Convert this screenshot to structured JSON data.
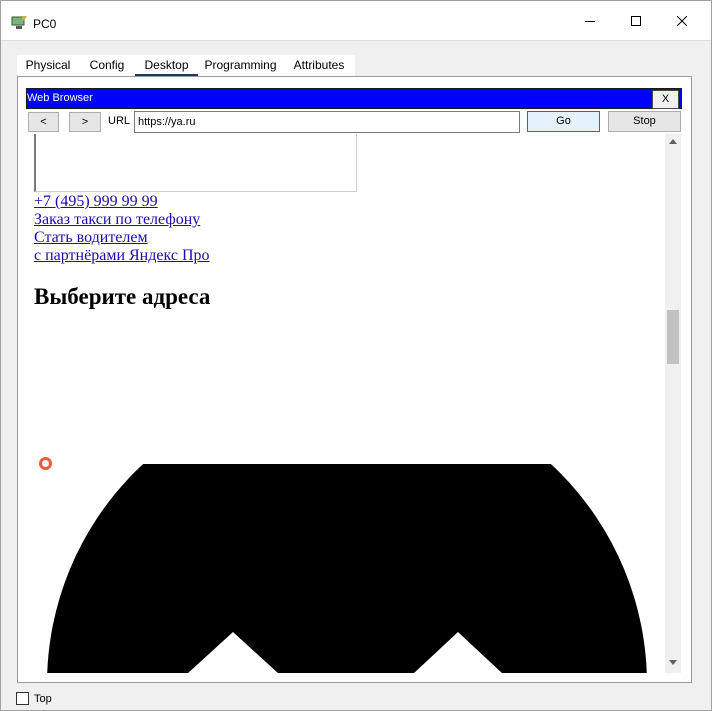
{
  "window": {
    "title": "PC0",
    "controls": {
      "minimize": "minimize-icon",
      "maximize": "maximize-icon",
      "close": "close-icon"
    }
  },
  "tabs": [
    {
      "label": "Physical",
      "active": false
    },
    {
      "label": "Config",
      "active": false
    },
    {
      "label": "Desktop",
      "active": true
    },
    {
      "label": "Programming",
      "active": false
    },
    {
      "label": "Attributes",
      "active": false
    }
  ],
  "browser": {
    "title": "Web Browser",
    "close_label": "X",
    "back_label": "<",
    "forward_label": ">",
    "url_label": "URL",
    "url_value": "https://ya.ru",
    "go_label": "Go",
    "stop_label": "Stop",
    "title_bar_color": "#0000ff"
  },
  "page": {
    "links": [
      "+7 (495) 999 99 99",
      "Заказ такси по телефону",
      "Стать водителем",
      "с партнёрами Яндекс Про"
    ],
    "heading": "Выберите адреса",
    "link_color": "#1a0dab",
    "marker_color": "#f05a3f"
  },
  "footer": {
    "top_label": "Top",
    "top_checked": false
  }
}
